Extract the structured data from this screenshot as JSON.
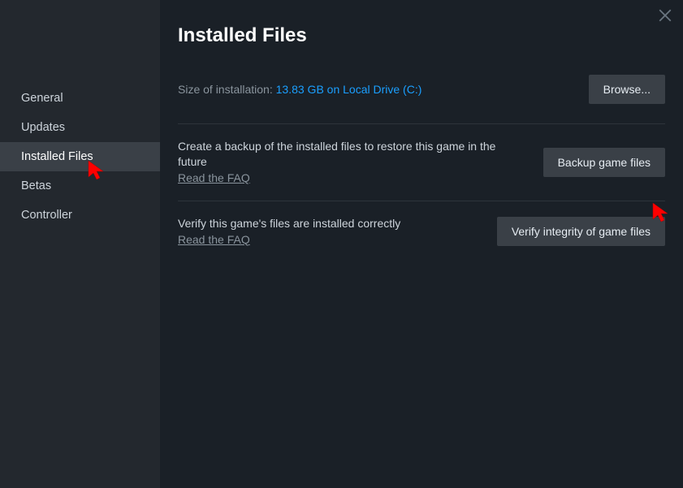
{
  "sidebar": {
    "items": [
      {
        "label": "General"
      },
      {
        "label": "Updates"
      },
      {
        "label": "Installed Files"
      },
      {
        "label": "Betas"
      },
      {
        "label": "Controller"
      }
    ]
  },
  "main": {
    "title": "Installed Files",
    "size_label": "Size of installation: ",
    "size_value": "13.83 GB on Local Drive (C:)",
    "browse_label": "Browse...",
    "backup": {
      "desc": "Create a backup of the installed files to restore this game in the future",
      "faq": "Read the FAQ",
      "button": "Backup game files"
    },
    "verify": {
      "desc": "Verify this game's files are installed correctly",
      "faq": "Read the FAQ",
      "button": "Verify integrity of game files"
    }
  }
}
